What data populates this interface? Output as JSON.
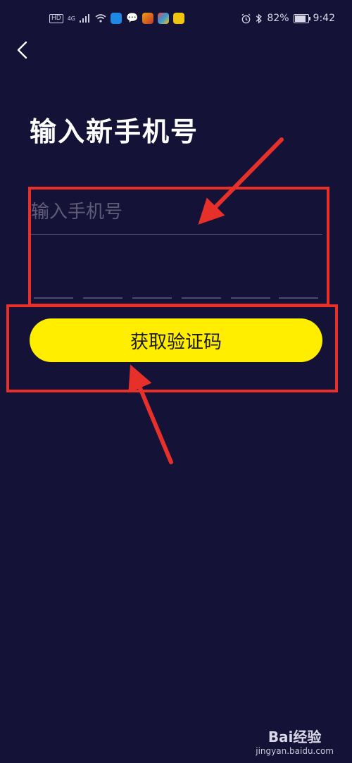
{
  "status_bar": {
    "left_indicators": [
      "HD",
      "4G"
    ],
    "battery_percent": "82%",
    "battery_level": 0.82,
    "time": "9:42"
  },
  "page": {
    "title": "输入新手机号",
    "phone_input": {
      "placeholder": "输入手机号",
      "value": ""
    },
    "code_digit_count": 6,
    "get_code_button_label": "获取验证码"
  },
  "annotations": {
    "highlight_color": "#e8302a",
    "highlights": [
      "phone-input-region",
      "get-code-button-region"
    ],
    "arrows": [
      "points-to-phone-input",
      "points-to-get-code-button"
    ]
  },
  "watermark": {
    "logo_text": "Bai经验",
    "sub_text": "jingyan.baidu.com"
  },
  "colors": {
    "background": "#151237",
    "button": "#ffee00",
    "button_text": "#1c1c1c",
    "placeholder": "#5f5c7a"
  }
}
